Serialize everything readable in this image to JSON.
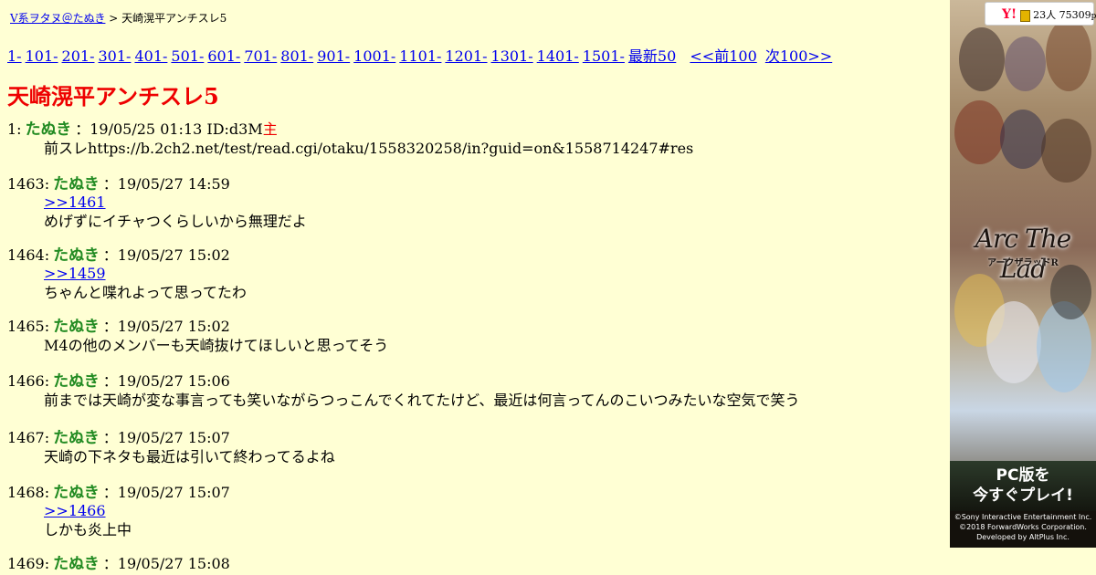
{
  "breadcrumb": {
    "board_link": "V系ヲタヌ＠たぬき",
    "separator": ">",
    "current": "天崎滉平アンチスレ5"
  },
  "pager": {
    "ranges": [
      "1-",
      "101-",
      "201-",
      "301-",
      "401-",
      "501-",
      "601-",
      "701-",
      "801-",
      "901-",
      "1001-",
      "1101-",
      "1201-",
      "1301-",
      "1401-",
      "1501-"
    ],
    "latest": "最新50",
    "prev": "<<前100",
    "next": "次100>>"
  },
  "thread": {
    "title": "天崎滉平アンチスレ5"
  },
  "posts": [
    {
      "num": "1:",
      "name": "たぬき",
      "meta": "：19/05/25 01:13 ID:d3M",
      "op_mark": "主",
      "anchor": "",
      "text": "前スレhttps://b.2ch2.net/test/read.cgi/otaku/1558320258/in?guid=on&1558714247#res"
    },
    {
      "num": "1463:",
      "name": "たぬき",
      "meta": "：19/05/27 14:59",
      "op_mark": "",
      "anchor": ">>1461",
      "text": "めげずにイチャつくらしいから無理だよ"
    },
    {
      "num": "1464:",
      "name": "たぬき",
      "meta": "：19/05/27 15:02",
      "op_mark": "",
      "anchor": ">>1459",
      "text": "ちゃんと喋れよって思ってたわ"
    },
    {
      "num": "1465:",
      "name": "たぬき",
      "meta": "：19/05/27 15:02",
      "op_mark": "",
      "anchor": "",
      "text": "M4の他のメンバーも天崎抜けてほしいと思ってそう"
    },
    {
      "num": "1466:",
      "name": "たぬき",
      "meta": "：19/05/27 15:06",
      "op_mark": "",
      "anchor": "",
      "text": "前までは天崎が変な事言っても笑いながらつっこんでくれてたけど、最近は何言ってんのこいつみたいな空気で笑う"
    },
    {
      "num": "1467:",
      "name": "たぬき",
      "meta": "：19/05/27 15:07",
      "op_mark": "",
      "anchor": "",
      "text": "天崎の下ネタも最近は引いて終わってるよね"
    },
    {
      "num": "1468:",
      "name": "たぬき",
      "meta": "：19/05/27 15:07",
      "op_mark": "",
      "anchor": ">>1466",
      "text": "しかも炎上中"
    },
    {
      "num": "1469:",
      "name": "たぬき",
      "meta": "：19/05/27 15:08",
      "op_mark": "",
      "anchor": "",
      "text": ""
    }
  ],
  "ad": {
    "badge_logo": "Y!",
    "badge_stats": "23人 75309",
    "badge_unit": "pv",
    "logo": "Arc The Lad",
    "logo_sub": "アークザラッドR",
    "cta_line1": "PC版を",
    "cta_line2": "今すぐプレイ!",
    "credit_1": "©Sony Interactive Entertainment Inc.",
    "credit_2": "©2018 ForwardWorks Corporation.",
    "credit_3": "Developed by AltPlus Inc.",
    "colors": {
      "cta_bg": "#1f2518",
      "credits_bg": "#14110c"
    }
  },
  "colors": {
    "background": "#ffffd4",
    "link": "#0000ee",
    "title": "#ee0000",
    "name": "#228b22",
    "op_mark": "#ee0000"
  }
}
